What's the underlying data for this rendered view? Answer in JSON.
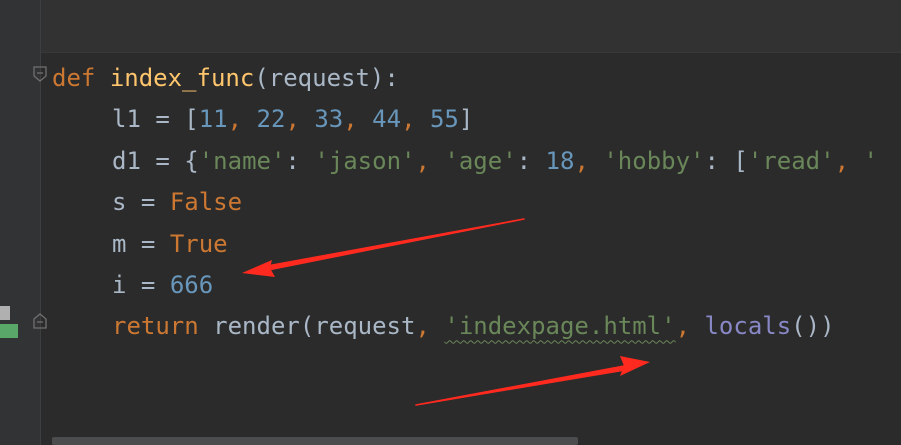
{
  "code": {
    "line1": {
      "keyword": "def",
      "func_name": "index_func",
      "open_paren": "(",
      "param": "request",
      "close": "):"
    },
    "line2": {
      "name": "l1",
      "assign": " = ",
      "bracket_open": "[",
      "items": [
        "11",
        "22",
        "33",
        "44",
        "55"
      ],
      "sep": ", ",
      "bracket_close": "]"
    },
    "line3": {
      "name": "d1",
      "assign": " = ",
      "brace_open": "{",
      "k1": "'name'",
      "colon": ": ",
      "v1": "'jason'",
      "sep": ", ",
      "k2": "'age'",
      "v2": "18",
      "k3": "'hobby'",
      "list_open": "[",
      "v3a": "'read'",
      "trail": "'"
    },
    "line4": {
      "name": "s",
      "assign": " = ",
      "value": "False"
    },
    "line5": {
      "name": "m",
      "assign": " = ",
      "value": "True"
    },
    "line6": {
      "name": "i",
      "assign": " = ",
      "value": "666"
    },
    "line7": {
      "keyword": "return",
      "space": " ",
      "func": "render",
      "open_paren": "(",
      "arg1": "request",
      "sep": ", ",
      "arg2": "'indexpage.html'",
      "builtin": "locals",
      "call": "()",
      "close": ")"
    }
  },
  "colors": {
    "background": "#2b2b2b",
    "keyword": "#cc7832",
    "function_def": "#ffc66d",
    "number": "#6897bb",
    "string": "#6a8759",
    "builtin": "#8888c6",
    "default_text": "#a9b7c6",
    "annotation_arrow": "#ff2a1f",
    "vcs_added": "#59a869"
  },
  "icons": {
    "fold_start": "fold-start-icon",
    "fold_end": "fold-end-icon",
    "vcs_change": "vcs-change-marker"
  }
}
